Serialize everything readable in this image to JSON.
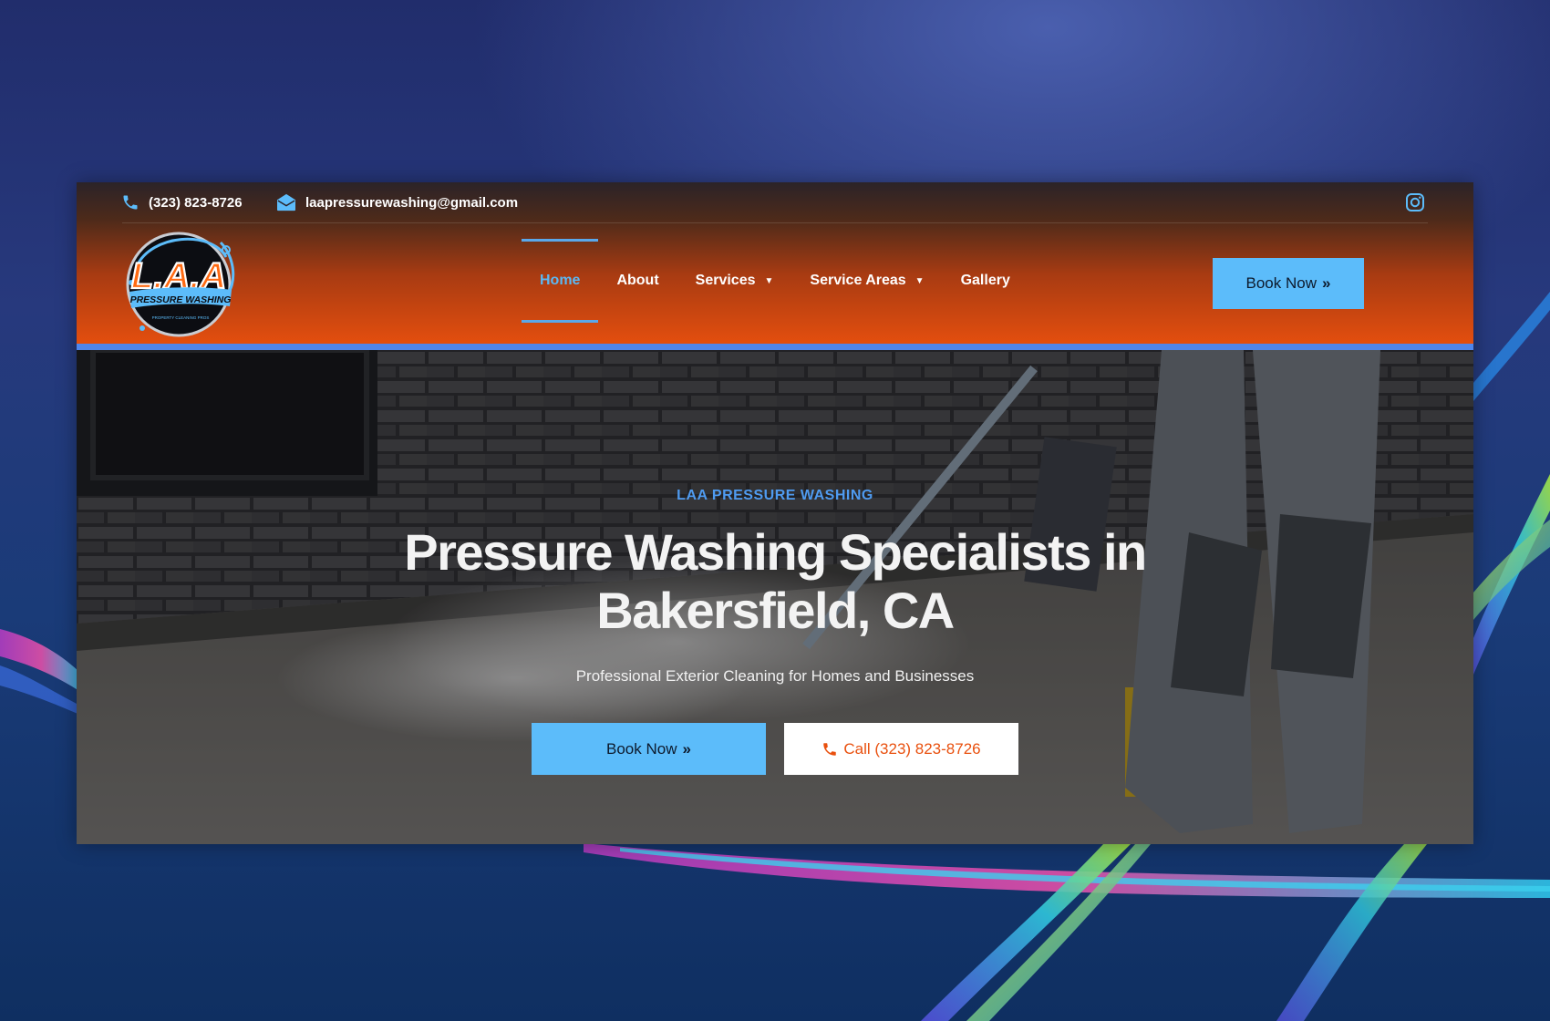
{
  "topbar": {
    "phone": "(323) 823-8726",
    "email": "laapressurewashing@gmail.com",
    "icons": {
      "phone": "phone-icon",
      "email": "envelope-icon",
      "social": "instagram-icon"
    }
  },
  "logo": {
    "main_text": "L.A.A",
    "banner_text": "PRESSURE WASHING",
    "tagline": "PROPERTY CLEANING PROS"
  },
  "nav": {
    "items": [
      {
        "label": "Home",
        "active": true
      },
      {
        "label": "About"
      },
      {
        "label": "Services",
        "dropdown": true
      },
      {
        "label": "Service Areas",
        "dropdown": true
      },
      {
        "label": "Gallery"
      }
    ]
  },
  "header_cta": {
    "label": "Book Now",
    "icon": "double-chevron-right-icon"
  },
  "hero": {
    "eyebrow": "LAA PRESSURE WASHING",
    "headline_line1": "Pressure Washing Specialists in",
    "headline_line2": "Bakersfield, CA",
    "subhead": "Professional Exterior Cleaning for Homes and Businesses",
    "book_label": "Book Now",
    "call_label": "Call (323) 823-8726"
  },
  "colors": {
    "accent_blue": "#5cbcfa",
    "brand_orange": "#e9500e",
    "stripe_blue": "#4f86ec",
    "eyebrow_blue": "#4f9bf0"
  }
}
